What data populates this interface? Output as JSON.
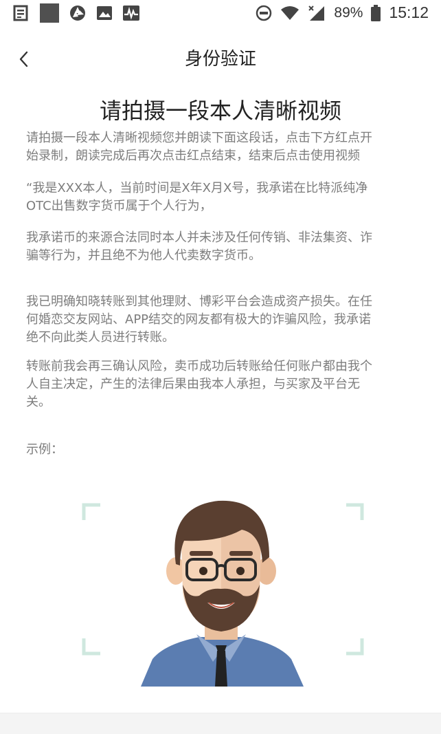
{
  "status_bar": {
    "battery_percent": "89%",
    "time": "15:12",
    "icons": [
      "news-icon",
      "app-square-icon",
      "aperture-icon",
      "image-icon",
      "pulse-icon",
      "dnd-icon",
      "wifi-icon",
      "signal-icon",
      "battery-icon"
    ]
  },
  "header": {
    "back_icon": "chevron-left-icon",
    "title": "身份验证"
  },
  "main": {
    "heading": "请拍摄一段本人清晰视频",
    "instruction": [
      "请拍摄一段本人清晰视频您并朗读下面这段话，点击下方红点开",
      "始录制，朗读完成后再次点击红点结束，结束后点击使用视频"
    ],
    "statement": [
      [
        "“我是XXX本人，当前时间是X年X月X号，我承诺在比特派纯净",
        "OTC出售数字货币属于个人行为，"
      ],
      [
        "我承诺币的来源合法同时本人并未涉及任何传销、非法集资、诈",
        "骗等行为，并且绝不为他人代卖数字货币。"
      ],
      [
        "我已明确知晓转账到其他理财、博彩平台会造成资产损失。在任",
        "何婚恋交友网站、APP结交的网友都有极大的诈骗风险，我承诺",
        "绝不向此类人员进行转账。"
      ],
      [
        "转账前我会再三确认风险，卖币成功后转账给任何账户都由我个",
        "人自主决定，产生的法律后果由我本人承担，与买家及平台无",
        "关。"
      ]
    ],
    "example_label": "示例：",
    "colors": {
      "frame_corner": "#cfe8df",
      "shirt": "#5b7db1",
      "hair": "#5a3f30",
      "skin": "#f5d4b8"
    }
  }
}
